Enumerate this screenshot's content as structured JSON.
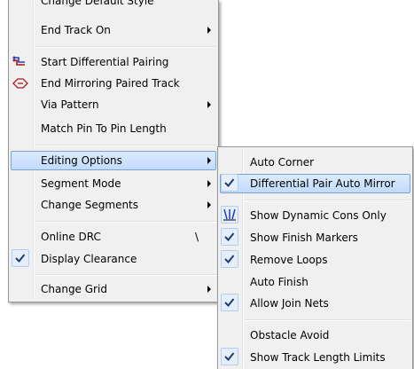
{
  "main_menu": {
    "items": [
      {
        "label": "Change Default Style"
      },
      {
        "label": "End Track On"
      },
      {
        "label": "Start Differential Pairing",
        "icon": "differential-pair-start-icon"
      },
      {
        "label": "End Mirroring Paired Track",
        "icon": "mirror-track-end-icon"
      },
      {
        "label": "Via Pattern"
      },
      {
        "label": "Match Pin To Pin Length"
      },
      {
        "label": "Editing Options"
      },
      {
        "label": "Segment Mode"
      },
      {
        "label": "Change Segments"
      },
      {
        "label": "Online DRC",
        "shortcut": "\\"
      },
      {
        "label": "Display Clearance",
        "checked": true
      },
      {
        "label": "Change Grid"
      }
    ]
  },
  "sub_menu": {
    "items": [
      {
        "label": "Auto Corner"
      },
      {
        "label": "Differential Pair Auto Mirror",
        "checked": true
      },
      {
        "label": "Show Dynamic Cons Only",
        "icon": "dynamic-cons-icon"
      },
      {
        "label": "Show Finish Markers",
        "checked": true
      },
      {
        "label": "Remove Loops",
        "checked": true
      },
      {
        "label": "Auto Finish"
      },
      {
        "label": "Allow Join Nets",
        "checked": true
      },
      {
        "label": "Obstacle Avoid"
      },
      {
        "label": "Show Track Length Limits",
        "checked": true
      }
    ]
  },
  "colors": {
    "highlight": "#c1dbfc",
    "highlight_border": "#7da2ce",
    "menu_bg": "#f0f0f0",
    "check_bg": "#e6eef8"
  }
}
